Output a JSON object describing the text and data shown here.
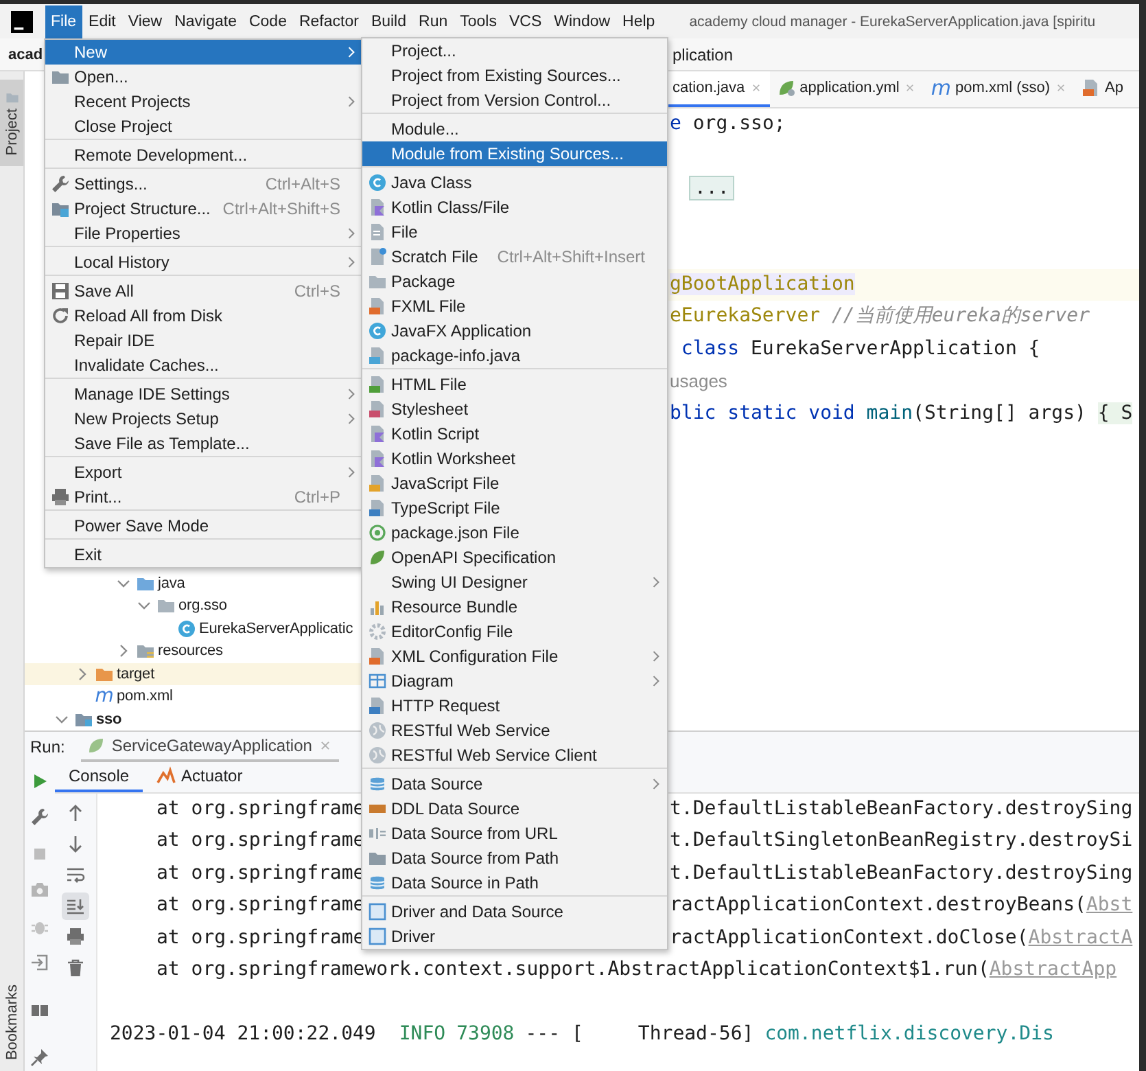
{
  "menu_bar": {
    "items": [
      {
        "label": "File",
        "selected": true
      },
      {
        "label": "Edit",
        "selected": false
      },
      {
        "label": "View",
        "selected": false
      },
      {
        "label": "Navigate",
        "selected": false
      },
      {
        "label": "Code",
        "selected": false
      },
      {
        "label": "Refactor",
        "selected": false
      },
      {
        "label": "Build",
        "selected": false
      },
      {
        "label": "Run",
        "selected": false
      },
      {
        "label": "Tools",
        "selected": false
      },
      {
        "label": "VCS",
        "selected": false
      },
      {
        "label": "Window",
        "selected": false
      },
      {
        "label": "Help",
        "selected": false
      }
    ],
    "window_title": "academy cloud manager - EurekaServerApplication.java [spiritu"
  },
  "navigation_bar": {
    "project": "acad",
    "breadcrumb": "plication"
  },
  "tool_window_stripe": {
    "top": "Project",
    "bottom": "Bookmarks"
  },
  "project_tree": [
    {
      "children": [
        {
          "children": [
            {
              "children": [
                {
                  "label": "java",
                  "kind": "source_folder",
                  "expanded": true,
                  "children": [
                    {
                      "label": "org.sso",
                      "kind": "package",
                      "expanded": true,
                      "children": [
                        {
                          "label": "EurekaServerApplicatic",
                          "kind": "class"
                        }
                      ]
                    }
                  ]
                },
                {
                  "label": "resources",
                  "kind": "resources_folder",
                  "expanded": false
                }
              ]
            }
          ]
        },
        {
          "label": "target",
          "kind": "excluded_folder",
          "expanded": false
        },
        {
          "label": "pom.xml",
          "icon_text": "m"
        }
      ]
    },
    {
      "label": "sso",
      "kind": "module",
      "expanded": true
    }
  ],
  "editor": {
    "tabs": [
      {
        "label": "cation.java",
        "selected": true,
        "close_button": true
      },
      {
        "label": "application.yml",
        "kind": "yaml",
        "selected": false,
        "close_button": true
      },
      {
        "label": "pom.xml (sso)",
        "icon_text": "m",
        "selected": false,
        "close_button": true
      },
      {
        "label": "Ap",
        "kind": "xml",
        "selected": false,
        "close_button": false
      }
    ],
    "lines": [
      {
        "highlighted": false,
        "tokens": [
          {
            "text": "e",
            "kind": "keyword"
          },
          {
            "text": " org.sso;",
            "kind": "plain"
          }
        ]
      },
      {
        "highlighted": false
      },
      {
        "highlighted": false,
        "tokens": [
          {
            "text": "...",
            "kind": "fold"
          }
        ]
      },
      {
        "highlighted": false
      },
      {
        "highlighted": false
      },
      {
        "highlighted": true,
        "tokens": [
          {
            "text": "gBootApplication",
            "kind": "annotation"
          }
        ]
      },
      {
        "highlighted": false,
        "tokens": [
          {
            "text": "eEurekaServer",
            "kind": "annotation"
          },
          {
            "text": " //当前使用eureka的server",
            "kind": "comment"
          }
        ]
      },
      {
        "highlighted": false,
        "tokens": [
          {
            "text": " class",
            "kind": "keyword"
          },
          {
            "text": " EurekaServerApplication {",
            "kind": "plain"
          }
        ]
      },
      {
        "highlighted": false,
        "tokens": [
          {
            "text": "usages",
            "kind": "hint"
          }
        ]
      },
      {
        "highlighted": false,
        "tokens": [
          {
            "text": "blic static void",
            "kind": "keyword"
          },
          {
            "text": " main",
            "kind": "method"
          },
          {
            "text": "(String[] args) ",
            "kind": "plain"
          },
          {
            "text": "{ S",
            "kind": "folded_body"
          }
        ]
      }
    ]
  },
  "run_panel": {
    "label": "Run:",
    "tabs": [
      {
        "label": "ServiceGatewayApplication",
        "selected": true
      }
    ],
    "console_tabs": [
      {
        "label": "Console",
        "selected": true
      },
      {
        "label": "Actuator",
        "selected": false
      }
    ],
    "toolbar_toggles": {
      "soft_wrap": false,
      "scroll_to_end": true
    },
    "lines": [
      {
        "kind": "trace_split",
        "left": "at org.springframe",
        "right": [
          {
            "text": "t.DefaultListableBeanFactory.destroySing",
            "kind": "plain"
          }
        ]
      },
      {
        "kind": "trace_split",
        "left": "at org.springframe",
        "right": [
          {
            "text": "t.DefaultSingletonBeanRegistry.destroySi",
            "kind": "plain"
          }
        ]
      },
      {
        "kind": "trace_split",
        "left": "at org.springframe",
        "right": [
          {
            "text": "t.DefaultListableBeanFactory.destroySing",
            "kind": "plain"
          }
        ]
      },
      {
        "kind": "trace_split",
        "left": "at org.springframe",
        "right": [
          {
            "text": "ractApplicationContext.destroyBeans(",
            "kind": "plain"
          },
          {
            "text": "Abst",
            "kind": "link"
          }
        ]
      },
      {
        "kind": "trace_split",
        "left": "at org.springframe",
        "right": [
          {
            "text": "ractApplicationContext.doClose(",
            "kind": "plain"
          },
          {
            "text": "AbstractA",
            "kind": "link"
          }
        ]
      },
      {
        "kind": "trace",
        "segments": [
          {
            "text": "at org.springframework.context.support.AbstractApplicationContext$1.run(",
            "kind": "plain"
          },
          {
            "text": "AbstractApp",
            "kind": "link"
          }
        ]
      },
      {
        "kind": "log",
        "segments": [
          {
            "text": "2023-01-04 21:00:22.049",
            "kind": "plain"
          },
          {
            "text": "INFO",
            "kind": "level"
          },
          {
            "text": "73908",
            "kind": "pid"
          },
          {
            "text": "--- [",
            "kind": "plain"
          },
          {
            "text": "Thread-56]",
            "kind": "plain"
          },
          {
            "text": "com.netflix.discovery.Dis",
            "kind": "logger"
          }
        ]
      }
    ]
  },
  "file_menu": {
    "sections": [
      [
        {
          "label": "New",
          "submenu": true,
          "selected": true
        },
        {
          "label": "Open...",
          "selected": false
        },
        {
          "label": "Recent Projects",
          "submenu": true,
          "selected": false
        },
        {
          "label": "Close Project",
          "selected": false
        }
      ],
      [
        {
          "label": "Remote Development...",
          "selected": false
        }
      ],
      [
        {
          "label": "Settings...",
          "shortcut": "Ctrl+Alt+S",
          "selected": false
        },
        {
          "label": "Project Structure...",
          "shortcut": "Ctrl+Alt+Shift+S",
          "selected": false
        },
        {
          "label": "File Properties",
          "submenu": true,
          "selected": false
        }
      ],
      [
        {
          "label": "Local History",
          "submenu": true,
          "selected": false
        }
      ],
      [
        {
          "label": "Save All",
          "shortcut": "Ctrl+S",
          "selected": false
        },
        {
          "label": "Reload All from Disk",
          "selected": false
        },
        {
          "label": "Repair IDE",
          "selected": false
        },
        {
          "label": "Invalidate Caches...",
          "selected": false
        }
      ],
      [
        {
          "label": "Manage IDE Settings",
          "submenu": true,
          "selected": false
        },
        {
          "label": "New Projects Setup",
          "submenu": true,
          "selected": false
        },
        {
          "label": "Save File as Template...",
          "selected": false
        }
      ],
      [
        {
          "label": "Export",
          "submenu": true,
          "selected": false
        },
        {
          "label": "Print...",
          "shortcut": "Ctrl+P",
          "selected": false
        }
      ],
      [
        {
          "label": "Power Save Mode",
          "selected": false
        }
      ],
      [
        {
          "label": "Exit",
          "selected": false
        }
      ]
    ]
  },
  "new_submenu": {
    "sections": [
      [
        {
          "label": "Project...",
          "selected": false
        },
        {
          "label": "Project from Existing Sources...",
          "selected": false
        },
        {
          "label": "Project from Version Control...",
          "selected": false
        }
      ],
      [
        {
          "label": "Module...",
          "selected": false
        },
        {
          "label": "Module from Existing Sources...",
          "selected": true
        }
      ],
      [
        {
          "label": "Java Class",
          "selected": false
        },
        {
          "label": "Kotlin Class/File",
          "selected": false
        },
        {
          "label": "File",
          "selected": false
        },
        {
          "label": "Scratch File",
          "shortcut": "Ctrl+Alt+Shift+Insert",
          "selected": false
        },
        {
          "label": "Package",
          "selected": false
        },
        {
          "label": "FXML File",
          "selected": false
        },
        {
          "label": "JavaFX Application",
          "selected": false
        },
        {
          "label": "package-info.java",
          "selected": false
        }
      ],
      [
        {
          "label": "HTML File",
          "selected": false
        },
        {
          "label": "Stylesheet",
          "selected": false
        },
        {
          "label": "Kotlin Script",
          "selected": false
        },
        {
          "label": "Kotlin Worksheet",
          "selected": false
        },
        {
          "label": "JavaScript File",
          "selected": false
        },
        {
          "label": "TypeScript File",
          "selected": false
        },
        {
          "label": "package.json File",
          "selected": false
        },
        {
          "label": "OpenAPI Specification",
          "selected": false
        },
        {
          "label": "Swing UI Designer",
          "submenu": true,
          "selected": false
        },
        {
          "label": "Resource Bundle",
          "selected": false
        },
        {
          "label": "EditorConfig File",
          "selected": false
        },
        {
          "label": "XML Configuration File",
          "submenu": true,
          "selected": false
        },
        {
          "label": "Diagram",
          "submenu": true,
          "selected": false
        },
        {
          "label": "HTTP Request",
          "selected": false
        },
        {
          "label": "RESTful Web Service",
          "selected": false
        },
        {
          "label": "RESTful Web Service Client",
          "selected": false
        }
      ],
      [
        {
          "label": "Data Source",
          "submenu": true,
          "selected": false
        },
        {
          "label": "DDL Data Source",
          "selected": false
        },
        {
          "label": "Data Source from URL",
          "selected": false
        },
        {
          "label": "Data Source from Path",
          "selected": false
        },
        {
          "label": "Data Source in Path",
          "selected": false
        }
      ],
      [
        {
          "label": "Driver and Data Source",
          "selected": false
        },
        {
          "label": "Driver",
          "selected": false
        }
      ]
    ]
  }
}
